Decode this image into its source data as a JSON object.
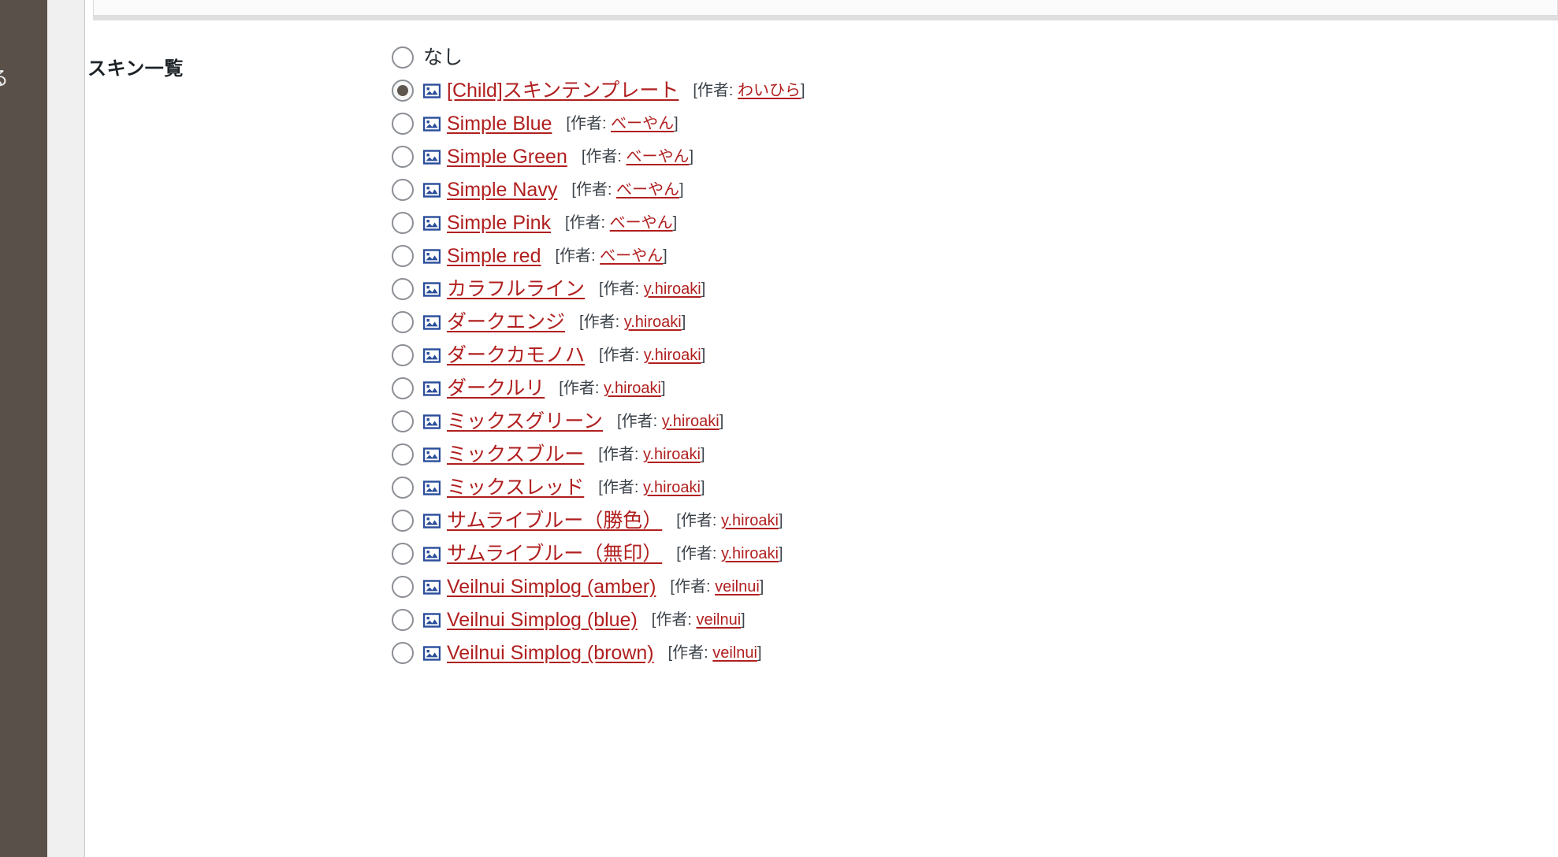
{
  "sidebar": {
    "clipped_label": "る",
    "background_color": "#595149"
  },
  "field": {
    "label": "スキン一覧"
  },
  "colors": {
    "link": "#b11f1f",
    "text": "#2c3338",
    "author_text": "#3c434a",
    "icon_blue": "#2a4d9b",
    "radio_border": "#8c8f94",
    "radio_dot": "#5d564e"
  },
  "author_prefix": "[作者: ",
  "author_suffix": "]",
  "skins": [
    {
      "name": "なし",
      "author": "",
      "selected": false,
      "has_icon": false,
      "is_link": false
    },
    {
      "name": "[Child]スキンテンプレート",
      "author": "わいひら",
      "selected": true,
      "has_icon": true,
      "is_link": true
    },
    {
      "name": "Simple Blue",
      "author": "べーやん",
      "selected": false,
      "has_icon": true,
      "is_link": true
    },
    {
      "name": "Simple Green",
      "author": "べーやん",
      "selected": false,
      "has_icon": true,
      "is_link": true
    },
    {
      "name": "Simple Navy",
      "author": "べーやん",
      "selected": false,
      "has_icon": true,
      "is_link": true
    },
    {
      "name": "Simple Pink",
      "author": "べーやん",
      "selected": false,
      "has_icon": true,
      "is_link": true
    },
    {
      "name": "Simple red",
      "author": "べーやん",
      "selected": false,
      "has_icon": true,
      "is_link": true
    },
    {
      "name": "カラフルライン",
      "author": "y.hiroaki",
      "selected": false,
      "has_icon": true,
      "is_link": true
    },
    {
      "name": "ダークエンジ",
      "author": "y.hiroaki",
      "selected": false,
      "has_icon": true,
      "is_link": true
    },
    {
      "name": "ダークカモノハ",
      "author": "y.hiroaki",
      "selected": false,
      "has_icon": true,
      "is_link": true
    },
    {
      "name": "ダークルリ",
      "author": "y.hiroaki",
      "selected": false,
      "has_icon": true,
      "is_link": true
    },
    {
      "name": "ミックスグリーン",
      "author": "y.hiroaki",
      "selected": false,
      "has_icon": true,
      "is_link": true
    },
    {
      "name": "ミックスブルー",
      "author": "y.hiroaki",
      "selected": false,
      "has_icon": true,
      "is_link": true
    },
    {
      "name": "ミックスレッド",
      "author": "y.hiroaki",
      "selected": false,
      "has_icon": true,
      "is_link": true
    },
    {
      "name": "サムライブルー（勝色）",
      "author": "y.hiroaki",
      "selected": false,
      "has_icon": true,
      "is_link": true
    },
    {
      "name": "サムライブルー（無印）",
      "author": "y.hiroaki",
      "selected": false,
      "has_icon": true,
      "is_link": true
    },
    {
      "name": "Veilnui Simplog (amber)",
      "author": "veilnui",
      "selected": false,
      "has_icon": true,
      "is_link": true
    },
    {
      "name": "Veilnui Simplog (blue)",
      "author": "veilnui",
      "selected": false,
      "has_icon": true,
      "is_link": true
    },
    {
      "name": "Veilnui Simplog (brown)",
      "author": "veilnui",
      "selected": false,
      "has_icon": true,
      "is_link": true
    }
  ]
}
